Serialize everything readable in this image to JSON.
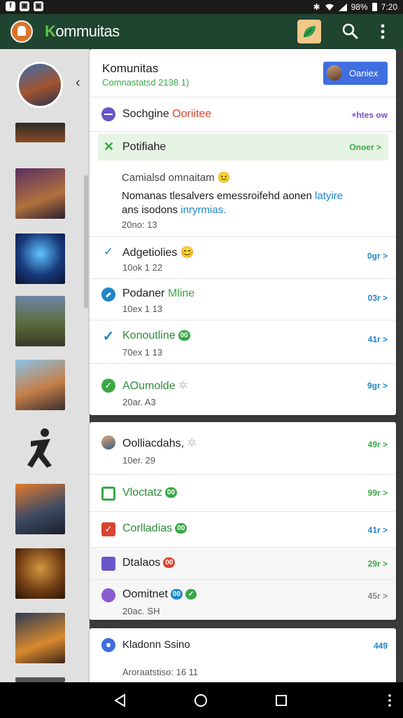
{
  "status_bar": {
    "left_icons": [
      "f",
      "▣",
      "▣"
    ],
    "battery": "98%",
    "time": "7:20"
  },
  "app_bar": {
    "title_prefix": "K",
    "title_rest": "ommuitas"
  },
  "header": {
    "title": "Komunitas",
    "subtitle": "Comnastatsd 2138 1)",
    "button_label": "Oaniex"
  },
  "notice": {
    "prefix": "Sochgine ",
    "highlight": "Ooriitee",
    "action": "+htes ow"
  },
  "active": {
    "label": "Potifiahe",
    "action": "Onoer >"
  },
  "comment": {
    "title": "Camialsd omnaitam 😐",
    "line1_plain": "Nomanas tlesalvers emessroifehd aonen ",
    "line1_link": "latyire",
    "line2_plain": "ans isodons ",
    "line2_link": "inryrmias.",
    "date": "20no: 13"
  },
  "list_a": [
    {
      "title": "Adgetiolies",
      "emoji": "😊",
      "sub": "10ok 1 22",
      "action": "0gr >"
    },
    {
      "title": "Podaner ",
      "title_link": "Mline",
      "sub": "10ex 1 13",
      "action": "03r >"
    },
    {
      "title": "Konoutline",
      "badge": "00",
      "sub": "70ex 1 13",
      "action": "41r >"
    },
    {
      "title": "AOumolde",
      "sub": "20ar. A3",
      "action": "9gr >"
    }
  ],
  "list_b": [
    {
      "title": "Oolliacdahs,",
      "sub": "10er. 29",
      "action": "49r >"
    },
    {
      "title": "Vloctatz",
      "badge": "00",
      "action": "99r >"
    },
    {
      "title": "Corlladias",
      "badge": "00",
      "action": "41r >"
    },
    {
      "title": "Dtalaos",
      "badge": "00",
      "action": "29r >"
    },
    {
      "title": "Oomitnet",
      "badge": "00",
      "sub": "20ac. SH",
      "action": "45r >"
    }
  ],
  "list_c": {
    "title": "Kladonn Ssino",
    "sub": "Aroraatstiso: 16 11",
    "action": "449"
  },
  "colors": {
    "app_bar": "#1f4430",
    "accent_green": "#3aa845",
    "link_blue": "#1f86c8",
    "header_button": "#3f6ee0",
    "active_row": "#e6f4e4"
  },
  "icons": {
    "app_logo": "knight-helmet-icon",
    "leaf": "leaf-icon",
    "search": "search-icon",
    "more": "more-vert-icon",
    "back": "back-nav-icon",
    "home": "home-nav-icon",
    "recents": "recents-nav-icon"
  }
}
